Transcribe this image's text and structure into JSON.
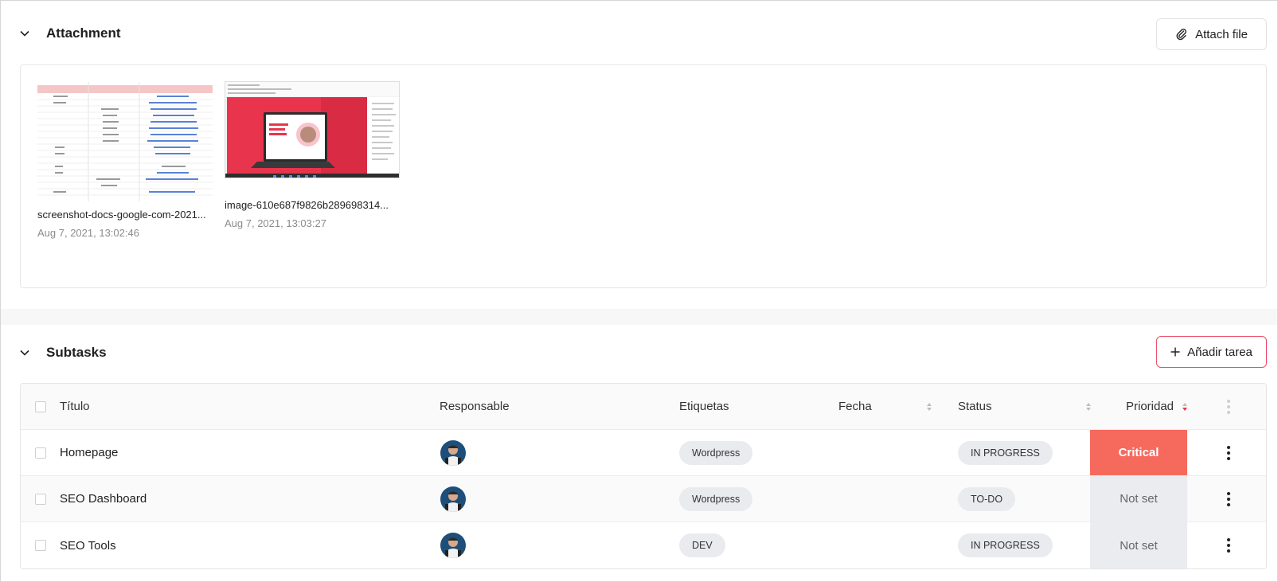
{
  "attachment": {
    "title": "Attachment",
    "attach_button": "Attach file",
    "files": [
      {
        "name": "screenshot-docs-google-com-2021...",
        "date": "Aug 7, 2021, 13:02:46"
      },
      {
        "name": "image-610e687f9826b289698314...",
        "date": "Aug 7, 2021, 13:03:27"
      }
    ]
  },
  "subtasks": {
    "title": "Subtasks",
    "add_button": "Añadir tarea",
    "columns": {
      "title": "Título",
      "owner": "Responsable",
      "tags": "Etiquetas",
      "date": "Fecha",
      "status": "Status",
      "priority": "Prioridad"
    },
    "rows": [
      {
        "title": "Homepage",
        "tag": "Wordpress",
        "status": "IN PROGRESS",
        "priority": "Critical"
      },
      {
        "title": "SEO Dashboard",
        "tag": "Wordpress",
        "status": "TO-DO",
        "priority": "Not set"
      },
      {
        "title": "SEO Tools",
        "tag": "DEV",
        "status": "IN PROGRESS",
        "priority": "Not set"
      }
    ]
  },
  "colors": {
    "critical": "#f66a5e",
    "accent_border": "#e8506a",
    "chip_bg": "#e9ebee"
  }
}
